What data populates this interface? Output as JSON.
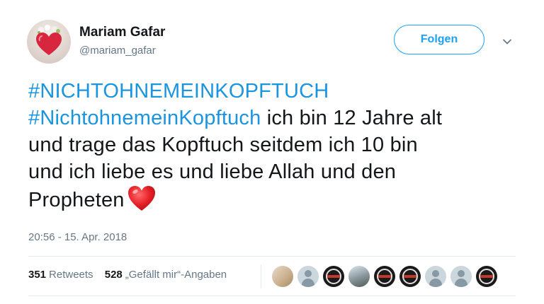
{
  "author": {
    "name": "Mariam Gafar",
    "handle": "@mariam_gafar",
    "avatar_icon": "heart-avatar"
  },
  "actions": {
    "follow_label": "Folgen",
    "menu_icon": "chevron-down-icon"
  },
  "tweet": {
    "lines": [
      {
        "hashtag": "#NICHTOHNEMEINKOPFTUCH",
        "text": ""
      },
      {
        "hashtag": "#NichtohnemeinKopftuch",
        "text": " ich bin 12 Jahre alt"
      },
      {
        "hashtag": "",
        "text": "und trage das Kopftuch seitdem ich 10 bin"
      },
      {
        "hashtag": "",
        "text": "und ich liebe es und liebe Allah und den"
      },
      {
        "hashtag": "",
        "text": "Propheten"
      }
    ],
    "emoji": "red-heart-emoji",
    "timestamp": "20:56 - 15. Apr. 2018"
  },
  "stats": {
    "retweets_count": "351",
    "retweets_label": "Retweets",
    "likes_count": "528",
    "likes_label": "„Gefällt mir“-Angaben"
  },
  "colors": {
    "accent": "#1da1f2",
    "hashtag": "#1b95e0",
    "secondary_text": "#657786",
    "heart": "#e0245e"
  },
  "likers": [
    "photo",
    "default",
    "logo",
    "photo",
    "logo",
    "logo",
    "default",
    "default",
    "logo"
  ]
}
